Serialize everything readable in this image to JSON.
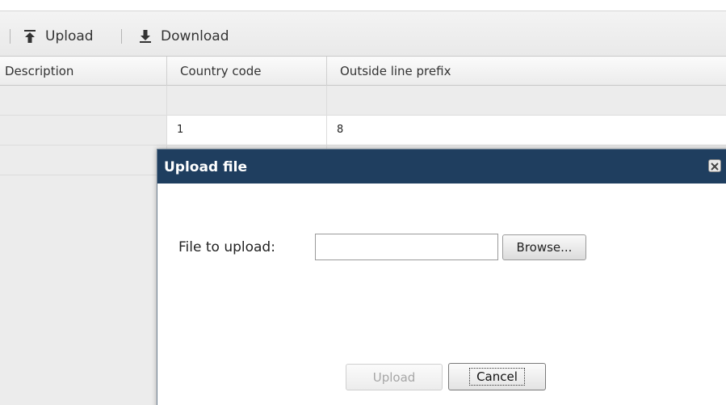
{
  "toolbar": {
    "upload_label": "Upload",
    "download_label": "Download",
    "icons": {
      "upload": "upload-arrow-icon",
      "download": "download-arrow-icon"
    }
  },
  "grid": {
    "columns": [
      "Description",
      "Country code",
      "Outside line prefix"
    ],
    "rows": [
      [
        "",
        "",
        ""
      ],
      [
        "",
        "1",
        "8"
      ],
      [
        "",
        "",
        ""
      ]
    ]
  },
  "dialog": {
    "title": "Upload file",
    "file_label": "File to upload:",
    "file_value": "",
    "browse_label": "Browse...",
    "upload_label": "Upload",
    "cancel_label": "Cancel",
    "colors": {
      "title_bar": "#1f3e5f"
    }
  }
}
